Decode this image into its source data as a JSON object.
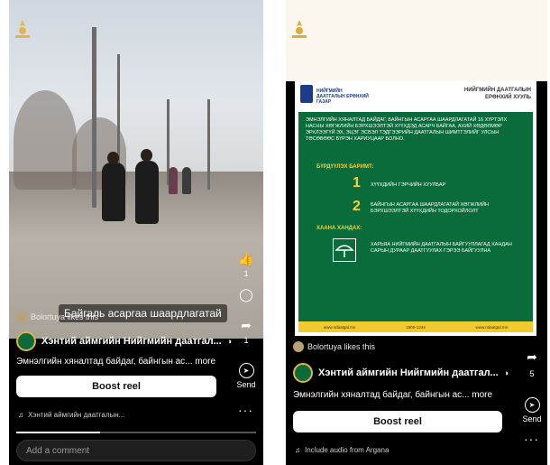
{
  "left": {
    "overlay_caption": "Байгаль асаргаа шаардлагатай",
    "liker_text": "Bolortuya likes this",
    "like_count": "1",
    "share_count": "1",
    "page_name": "Хэнтий аймгийн Нийгмийн даатгал...",
    "caption": "Эмнэлгийн хяналтад байдаг, байнгын ас... more",
    "boost_label": "Boost reel",
    "send_label": "Send",
    "audio_text": "Хэнтий аймгийн даатгалын...",
    "progress": 0.35,
    "comment_placeholder": "Add a comment"
  },
  "right": {
    "liker_text": "Bolortuya likes this",
    "share_count": "5",
    "page_name": "Хэнтий аймгийн Нийгмийн даатгал...",
    "caption": "Эмнэлгийн хяналтад байдаг, байнгын ас... more",
    "boost_label": "Boost reel",
    "send_label": "Send",
    "audio_text": "Include audio from Argana",
    "poster": {
      "agency": "НИЙГМИЙН ДААТГАЛЫН ЕРӨНХИЙ ГАЗАР",
      "org_line1": "НИЙГМИЙН ДААТГАЛЫН",
      "org_line2": "ЕРӨНХИЙ ХУУЛЬ",
      "intro": "ЭМНЭЛГИЙН ХЯНАЛТАД БАЙДАГ, БАЙНГЫН АСАРГАА ШААРДЛАГАТАЙ 16 ХҮРТЭЛХ НАСНЫ ХӨГЖЛИЙН БЭРХШЭЭЛТЭЙ ХҮҮХДЭД АСАРЧ БАЙГАА, АХИЙ ХӨДӨЛМӨР ЭРХЛЭЭГҮЙ ЭХ, ЭЦЭГ ЭСВЭЛ ТЭДГЭЭРИЙН ДААТГАЛЫН ШИМТГЭЛИЙГ УЛСЫН ТӨСӨВӨӨС БҮРЭН ХАРИУЦААР БОЛНО.",
      "docs_heading": "БҮРДҮҮЛЭХ БАРИМТ:",
      "doc1_num": "1",
      "doc1_text": "ХҮҮХДИЙН ГЭРЧИЙН ХУУЛБАР",
      "doc2_num": "2",
      "doc2_text": "БАЙНГЫН АСАРГАА ШААРДЛАГАТАЙ ХӨГЖЛИЙН БЭРХШЭЭЛТЭЙ ХҮҮХДИЙН ТОДОРХОЙЛОЛТ",
      "where_heading": "ХААНА ХАНДАХ:",
      "where_text": "ХАРЬЯА НИЙГМИЙН ДААТГАЛЫН БАЙГУУЛЛАГАД ХАНДАН САРЫН ДУРААР ДААТГУУЛАХ ГЭРЭЭ БАЙГУУЛНА",
      "footer1": "www.ndaatgal.mn",
      "footer2": "1800-1234",
      "footer3": "www.ndaatgal.mn"
    }
  }
}
